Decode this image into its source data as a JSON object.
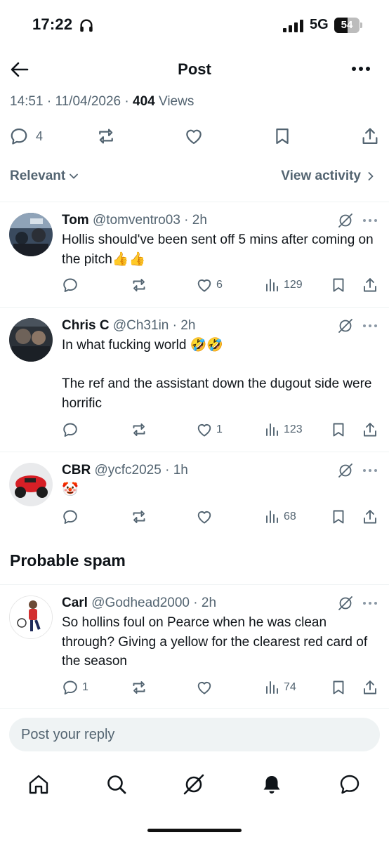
{
  "status_bar": {
    "time": "17:22",
    "network": "5G",
    "battery_level": "54",
    "battery_fraction": 0.54
  },
  "header": {
    "title": "Post",
    "back_icon": "arrow-left-icon",
    "more_icon": "more-horizontal-icon"
  },
  "post_meta": {
    "time": "14:51",
    "date": "11/04/2026",
    "views_count": "404",
    "views_label": "Views"
  },
  "post_actions": {
    "replies": "4"
  },
  "sort": {
    "relevant_label": "Relevant",
    "view_activity_label": "View activity"
  },
  "replies": [
    {
      "author": "Tom",
      "handle": "@tomventro03",
      "age": "2h",
      "text": "Hollis should've been sent off 5 mins after coming on the pitch👍👍",
      "reply_count": "",
      "like_count": "6",
      "view_count": "129"
    },
    {
      "author": "Chris C",
      "handle": "@Ch31in",
      "age": "2h",
      "text": "In what fucking world 🤣🤣\n\nThe ref and the assistant down the dugout side were horrific",
      "reply_count": "",
      "like_count": "1",
      "view_count": "123"
    },
    {
      "author": "CBR",
      "handle": "@ycfc2025",
      "age": "1h",
      "text": "🤡",
      "reply_count": "",
      "like_count": "",
      "view_count": "68"
    }
  ],
  "spam_section": {
    "title": "Probable spam",
    "replies": [
      {
        "author": "Carl",
        "handle": "@Godhead2000",
        "age": "2h",
        "text": "So hollins foul on Pearce when he was clean through? Giving a yellow for the clearest red card of the season",
        "reply_count": "1",
        "like_count": "",
        "view_count": "74"
      }
    ]
  },
  "reply_box": {
    "placeholder": "Post your reply"
  },
  "bottom_nav": [
    "home-icon",
    "search-icon",
    "grok-icon",
    "notifications-bell-icon",
    "messages-icon"
  ],
  "colors": {
    "text_primary": "#0f1419",
    "text_secondary": "#536471",
    "divider": "#eff3f4"
  }
}
